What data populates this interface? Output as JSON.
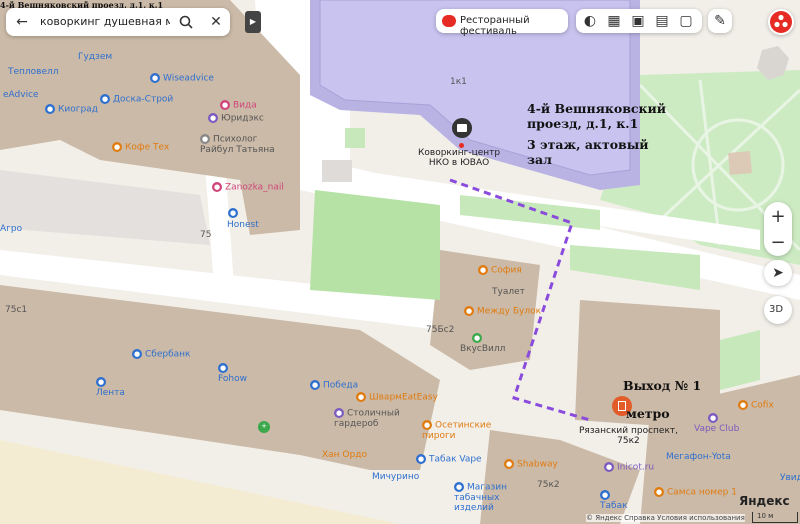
{
  "page_header": "4-й Вешняковский проезд, д.1, к.1",
  "search": {
    "query": "коворкинг душевная москва ра"
  },
  "festival_chip": "Ресторанный фестиваль",
  "controls": {
    "zoom_in": "+",
    "zoom_out": "−",
    "view_3d": "3D"
  },
  "annotations": {
    "address_line1": "4-й Вешняковский",
    "address_line2": "проезд, д.1, к.1",
    "floor_line1": "3 этаж, актовый",
    "floor_line2": "зал",
    "exit_label": "Выход № 1",
    "metro_label": "метро"
  },
  "buildings": {
    "b1k1": "1к1",
    "b75": "75",
    "b75c1": "75с1",
    "b75b2": "75Бс2",
    "b75k2": "75к2"
  },
  "pois": {
    "teplovell": "Тепловелл",
    "gudzem": "Гудзем",
    "wiseadvice": "Wiseadvice",
    "eadvice": "eAdvice",
    "doska": "Доска-Строй",
    "vida": "Вида",
    "kiosrad": "Киоград",
    "yuridzeks": "Юридэкс",
    "kofetex": "Кофе Тех",
    "psiholog": "Психолог\nРайбул Татьяна",
    "zanozka": "Zanozka_nail",
    "honest": "Honest",
    "agro": "Агро",
    "coworking": "Коворкинг-центр\nНКО в ЮВАО",
    "sofia": "София",
    "toilet": "Туалет",
    "mezhdu": "Между Булок",
    "vkusvill": "ВкусВилл",
    "sberbank": "Сбербанк",
    "fohow": "Fohow",
    "lenta": "Лента",
    "pobeda": "Победа",
    "shaurma": "ШвармEatEasy",
    "stolichny": "Столичный\nгардероб",
    "osetinskie": "Осетинские\nпироги",
    "han": "Хан Ордо",
    "tabakvape": "Табак Vape",
    "michurino": "Мичурино",
    "magazin": "Магазин\nтабачных\nизделий",
    "shabway": "Shabway",
    "inicot": "Inicot.ru",
    "tabak": "Табак",
    "vape_club": "Vape Club",
    "megafon": "Мегафон-Yota",
    "samsa": "Самса номер 1",
    "cofix": "Cofix",
    "uvid": "Увид",
    "ryazansky": "Рязанский проспект,\n75к2"
  },
  "footer": {
    "brand": "Яндекс",
    "links": "© Яндекс  Справка  Условия использования",
    "scale": "10 м"
  },
  "colors": {
    "route": "#8a4bdc",
    "accent": "#e62b24",
    "park": "#c8ecc0",
    "building": "#cbbaa7"
  }
}
